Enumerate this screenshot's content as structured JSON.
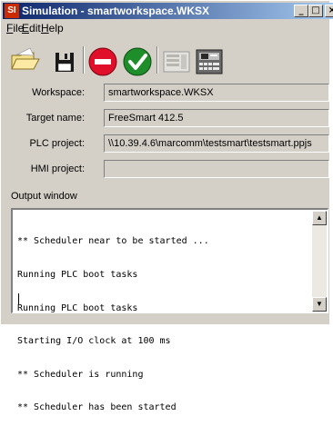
{
  "window": {
    "app_icon": "SI",
    "title": "Simulation - smartworkspace.WKSX",
    "controls": {
      "minimize": "_",
      "maximize": "□",
      "close": "×"
    }
  },
  "menu": {
    "items": [
      {
        "mnemonic": "F",
        "rest": "ile"
      },
      {
        "mnemonic": "E",
        "rest": "dit"
      },
      {
        "mnemonic": "H",
        "rest": "elp"
      }
    ]
  },
  "toolbar": {
    "buttons": [
      {
        "icon": "open-folder-icon"
      },
      {
        "icon": "save-floppy-icon"
      },
      {
        "icon": "stop-icon",
        "color": "#e0102a"
      },
      {
        "icon": "start-check-icon",
        "color": "#1e8e2a"
      },
      {
        "icon": "panel-view-icon",
        "disabled": true
      },
      {
        "icon": "hmi-device-icon"
      }
    ]
  },
  "fields": {
    "workspace": {
      "label": "Workspace:",
      "value": "smartworkspace.WKSX"
    },
    "target": {
      "label": "Target name:",
      "value": "FreeSmart 412.5"
    },
    "plc": {
      "label": "PLC project:",
      "value": "\\\\10.39.4.6\\marcomm\\testsmart\\testsmart.ppjs"
    },
    "hmi": {
      "label": "HMI project:",
      "value": ""
    }
  },
  "output": {
    "label": "Output window",
    "lines": [
      "** Scheduler near to be started ...",
      "Running PLC boot tasks",
      "Running PLC boot tasks",
      "Starting I/O clock at 100 ms",
      "** Scheduler is running",
      "** Scheduler has been started"
    ],
    "scroll_up": "▲",
    "scroll_down": "▼"
  }
}
